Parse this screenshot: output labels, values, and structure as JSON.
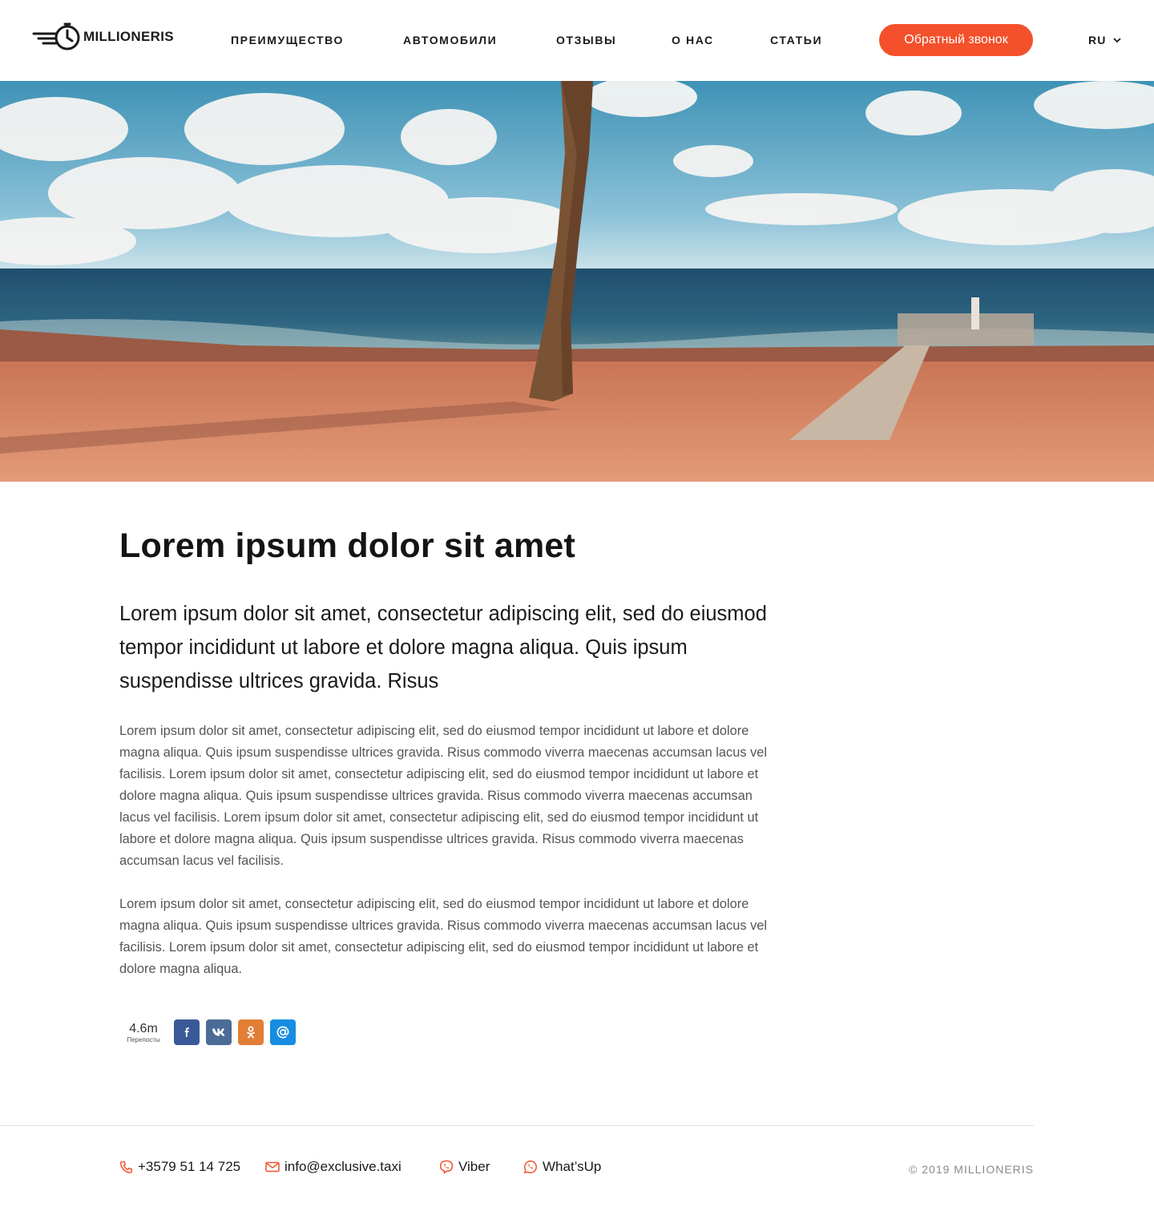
{
  "header": {
    "brand": "MILLIONERIS",
    "nav": [
      {
        "label": "ПРЕИМУЩЕСТВО"
      },
      {
        "label": "АВТОМОБИЛИ"
      },
      {
        "label": "ОТЗЫВЫ"
      },
      {
        "label": "О НАС"
      },
      {
        "label": "СТАТЬИ"
      }
    ],
    "cta_label": "Обратный звонок",
    "language": "RU"
  },
  "hero": {
    "icon": "beach-palm-photo"
  },
  "article": {
    "title": "Lorem ipsum dolor sit amet",
    "lead": "Lorem ipsum dolor sit amet, consectetur adipiscing elit, sed do eiusmod tempor incididunt ut labore et dolore magna aliqua. Quis ipsum suspendisse ultrices gravida. Risus",
    "paragraphs": [
      "Lorem ipsum dolor sit amet, consectetur adipiscing elit, sed do eiusmod tempor incididunt ut labore et dolore magna aliqua. Quis ipsum suspendisse ultrices gravida. Risus commodo viverra maecenas accumsan lacus vel facilisis. Lorem ipsum dolor sit amet, consectetur adipiscing elit, sed do eiusmod tempor incididunt ut labore et dolore magna aliqua. Quis ipsum suspendisse ultrices gravida. Risus commodo viverra maecenas accumsan lacus vel facilisis. Lorem ipsum dolor sit amet, consectetur adipiscing elit, sed do eiusmod tempor incididunt ut labore et dolore magna aliqua. Quis ipsum suspendisse ultrices gravida. Risus commodo viverra maecenas accumsan lacus vel facilisis.",
      "Lorem ipsum dolor sit amet, consectetur adipiscing elit, sed do eiusmod tempor incididunt ut labore et dolore magna aliqua. Quis ipsum suspendisse ultrices gravida. Risus commodo viverra maecenas accumsan lacus vel facilisis. Lorem ipsum dolor sit amet, consectetur adipiscing elit, sed do eiusmod tempor incididunt ut labore et dolore magna aliqua."
    ]
  },
  "share": {
    "count": "4.6m",
    "count_label": "Перепосты",
    "buttons": [
      {
        "icon": "facebook-icon",
        "glyph": "f",
        "color": "#3b5998"
      },
      {
        "icon": "vk-icon",
        "glyph": "vk",
        "color": "#4a6c96"
      },
      {
        "icon": "odnoklassniki-icon",
        "glyph": "ok",
        "color": "#e27e35"
      },
      {
        "icon": "mail-ru-icon",
        "glyph": "@",
        "color": "#168de2"
      }
    ]
  },
  "footer": {
    "phone": "+3579 51 14 725",
    "email": "info@exclusive.taxi",
    "viber": "Viber",
    "whatsapp": "What’sUp",
    "copyright": "© 2019 MILLIONERIS"
  },
  "colors": {
    "accent": "#f4502b",
    "text": "#1a1a1a",
    "muted": "#555555"
  }
}
